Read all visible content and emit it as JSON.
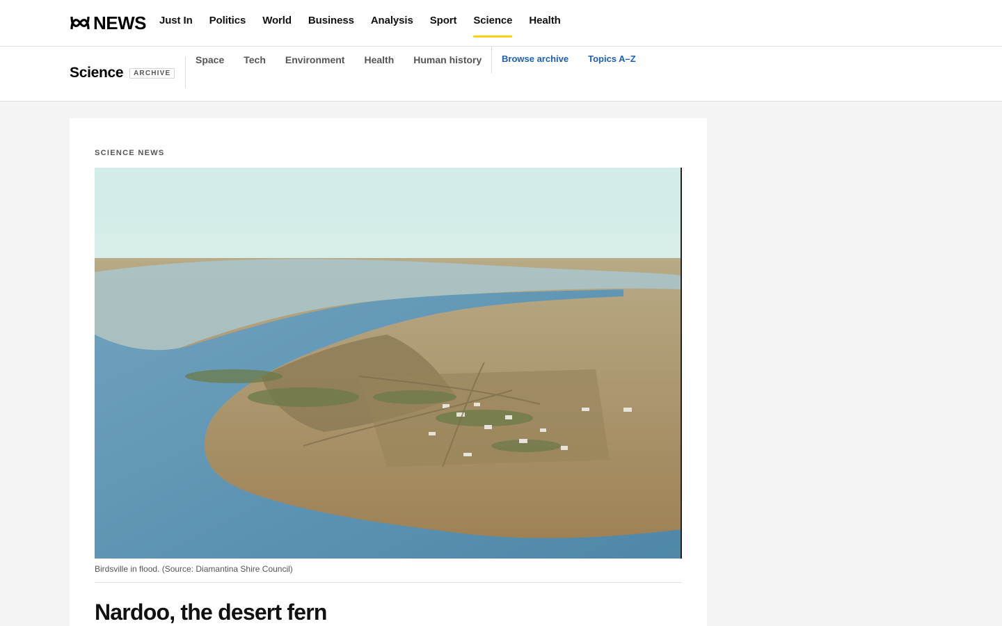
{
  "header": {
    "logo_text": "NEWS",
    "nav": [
      {
        "label": "Just In"
      },
      {
        "label": "Politics"
      },
      {
        "label": "World"
      },
      {
        "label": "Business"
      },
      {
        "label": "Analysis"
      },
      {
        "label": "Sport"
      },
      {
        "label": "Science",
        "active": true
      },
      {
        "label": "Health"
      }
    ],
    "accent_color": "#ffcf1a"
  },
  "section": {
    "title": "Science",
    "badge": "ARCHIVE",
    "subnav": [
      "Space",
      "Tech",
      "Environment",
      "Health",
      "Human history"
    ],
    "utility_links": [
      "Browse archive",
      "Topics A–Z"
    ],
    "link_color": "#1c5fb5"
  },
  "article": {
    "kicker": "SCIENCE NEWS",
    "image_description_icon": "aerial-flood-photo",
    "caption": "Birdsville in flood. (Source: Diamantina Shire Council)",
    "headline": "Nardoo, the desert fern"
  }
}
